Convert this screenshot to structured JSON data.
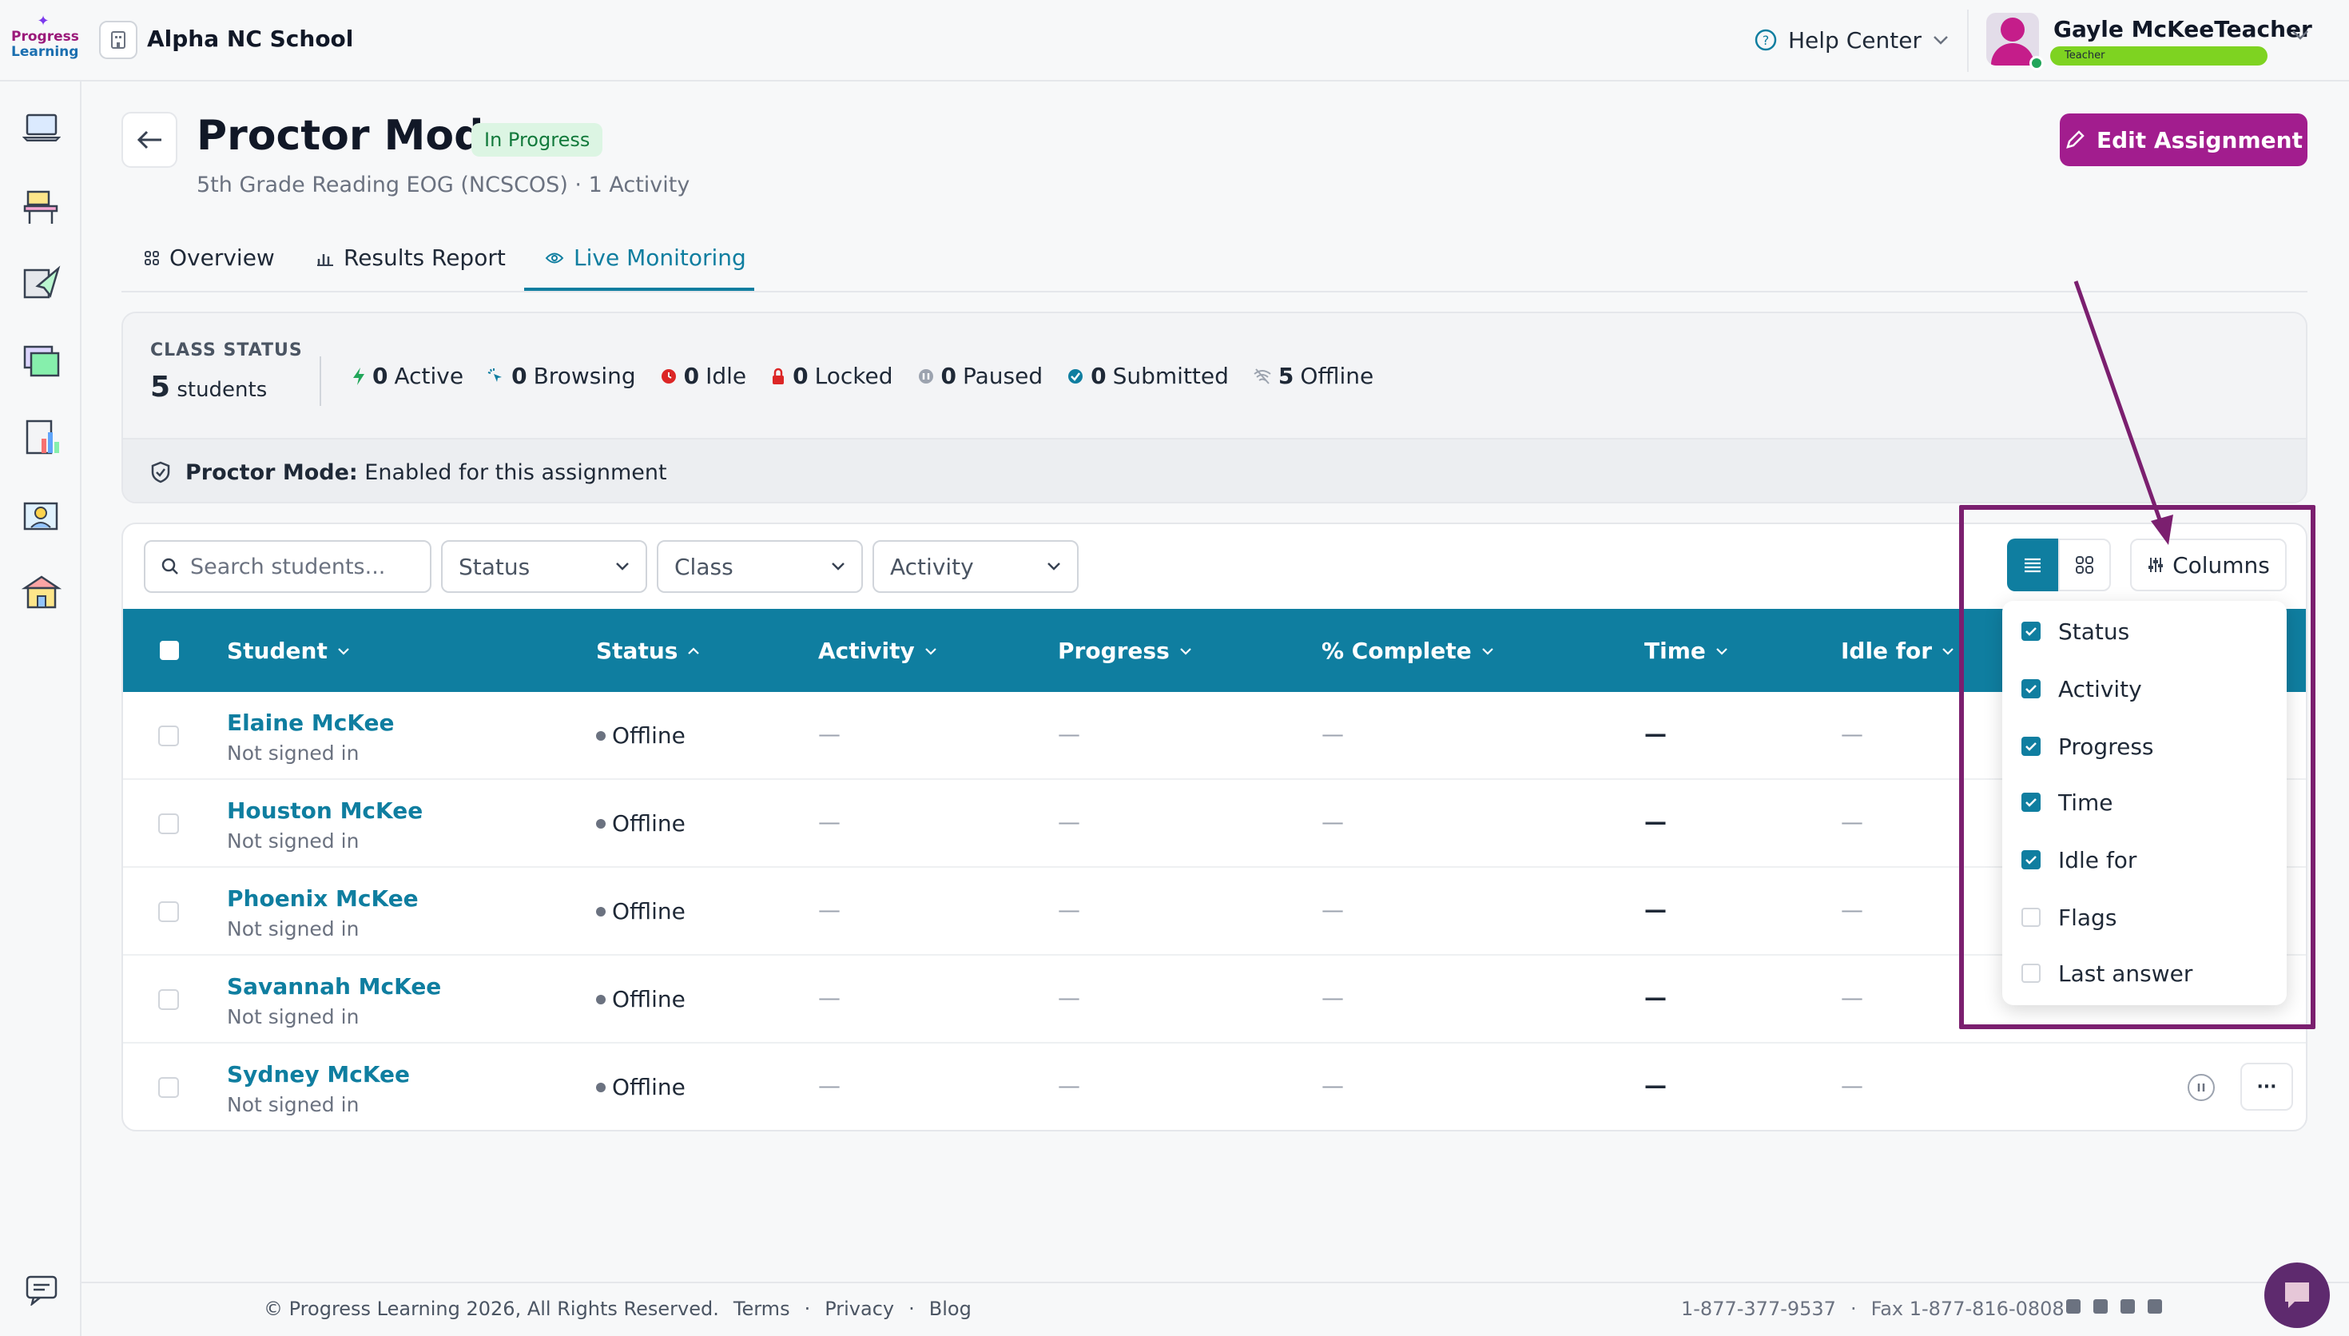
{
  "brand": {
    "line1": "Progress",
    "line2": "Learning"
  },
  "header": {
    "school": "Alpha NC School",
    "help": "Help Center",
    "user_name": "Gayle McKeeTeacher",
    "user_role": "Teacher"
  },
  "page": {
    "title": "Proctor Mode",
    "status": "In Progress",
    "subtitle": "5th Grade Reading EOG (NCSCOS)  ·  1 Activity",
    "edit_button": "Edit Assignment"
  },
  "tabs": [
    {
      "label": "Overview",
      "active": false
    },
    {
      "label": "Results Report",
      "active": false
    },
    {
      "label": "Live Monitoring",
      "active": true
    }
  ],
  "class_status": {
    "label": "CLASS STATUS",
    "count": "5",
    "count_label": "students",
    "metrics": [
      {
        "value": "0",
        "label": "Active"
      },
      {
        "value": "0",
        "label": "Browsing"
      },
      {
        "value": "0",
        "label": "Idle"
      },
      {
        "value": "0",
        "label": "Locked"
      },
      {
        "value": "0",
        "label": "Paused"
      },
      {
        "value": "0",
        "label": "Submitted"
      },
      {
        "value": "5",
        "label": "Offline"
      }
    ],
    "proctor_label": "Proctor Mode:",
    "proctor_text": "Enabled for this assignment"
  },
  "filters": {
    "search_placeholder": "Search students...",
    "status": "Status",
    "class": "Class",
    "activity": "Activity"
  },
  "toolbar": {
    "columns": "Columns"
  },
  "table": {
    "headers": [
      "Student",
      "Status",
      "Activity",
      "Progress",
      "% Complete",
      "Time",
      "Idle for"
    ],
    "rows": [
      {
        "name": "Elaine McKee",
        "sub": "Not signed in",
        "status": "Offline",
        "activity": "—",
        "progress": "—",
        "complete": "—",
        "time": "—",
        "idle": "—"
      },
      {
        "name": "Houston McKee",
        "sub": "Not signed in",
        "status": "Offline",
        "activity": "—",
        "progress": "—",
        "complete": "—",
        "time": "—",
        "idle": "—"
      },
      {
        "name": "Phoenix McKee",
        "sub": "Not signed in",
        "status": "Offline",
        "activity": "—",
        "progress": "—",
        "complete": "—",
        "time": "—",
        "idle": "—"
      },
      {
        "name": "Savannah McKee",
        "sub": "Not signed in",
        "status": "Offline",
        "activity": "—",
        "progress": "—",
        "complete": "—",
        "time": "—",
        "idle": "—"
      },
      {
        "name": "Sydney McKee",
        "sub": "Not signed in",
        "status": "Offline",
        "activity": "—",
        "progress": "—",
        "complete": "—",
        "time": "—",
        "idle": "—"
      }
    ],
    "more": "···"
  },
  "columns_menu": [
    {
      "label": "Status",
      "checked": true
    },
    {
      "label": "Activity",
      "checked": true
    },
    {
      "label": "Progress",
      "checked": true
    },
    {
      "label": "Time",
      "checked": true
    },
    {
      "label": "Idle for",
      "checked": true
    },
    {
      "label": "Flags",
      "checked": false
    },
    {
      "label": "Last answer",
      "checked": false
    }
  ],
  "footer": {
    "copyright": "© Progress Learning 2026, All Rights Reserved.",
    "terms": "Terms",
    "privacy": "Privacy",
    "blog": "Blog",
    "phone": "1-877-377-9537",
    "fax": "Fax 1-877-816-0808",
    "sep": "·"
  },
  "colors": {
    "accent": "#0f7ea0",
    "brand": "#a21d8e",
    "annotation": "#7b1f6f"
  }
}
